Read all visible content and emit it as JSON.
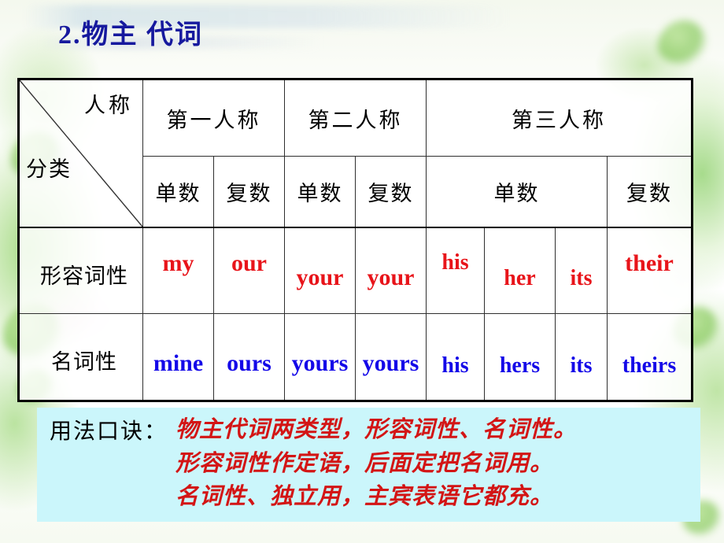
{
  "slide": {
    "title": "2.物主 代词",
    "title_color": "#16199e",
    "accent_red": "#e8141a",
    "accent_blue": "#1408e8",
    "mnemonic_bg": "#cbf6fb"
  },
  "table": {
    "corner": {
      "person_label": "人称",
      "category_label": "分类"
    },
    "person_headers": [
      {
        "label": "第一人称"
      },
      {
        "label": "第二人称"
      },
      {
        "label": "第三人称"
      }
    ],
    "number_headers": [
      {
        "label": "单数"
      },
      {
        "label": "复数"
      },
      {
        "label": "单数"
      },
      {
        "label": "复数"
      },
      {
        "label": "单数"
      },
      {
        "label": "复数"
      }
    ],
    "rows": [
      {
        "label": "形容词性",
        "color": "#e8141a",
        "cells": [
          {
            "text": "my"
          },
          {
            "text": "our"
          },
          {
            "text": "your"
          },
          {
            "text": "your"
          },
          {
            "text": "his"
          },
          {
            "text": "her"
          },
          {
            "text": "its"
          },
          {
            "text": "their"
          }
        ]
      },
      {
        "label": "名词性",
        "color": "#1408e8",
        "cells": [
          {
            "text": "mine"
          },
          {
            "text": "ours"
          },
          {
            "text": "yours"
          },
          {
            "text": "yours"
          },
          {
            "text": "his"
          },
          {
            "text": "hers"
          },
          {
            "text": "its"
          },
          {
            "text": "theirs"
          }
        ]
      }
    ]
  },
  "mnemonic": {
    "label": "用法口诀：",
    "lines": [
      "物主代词两类型，形容词性、名词性。",
      "形容词性作定语，后面定把名词用。",
      "名词性、独立用，主宾表语它都充。"
    ]
  }
}
